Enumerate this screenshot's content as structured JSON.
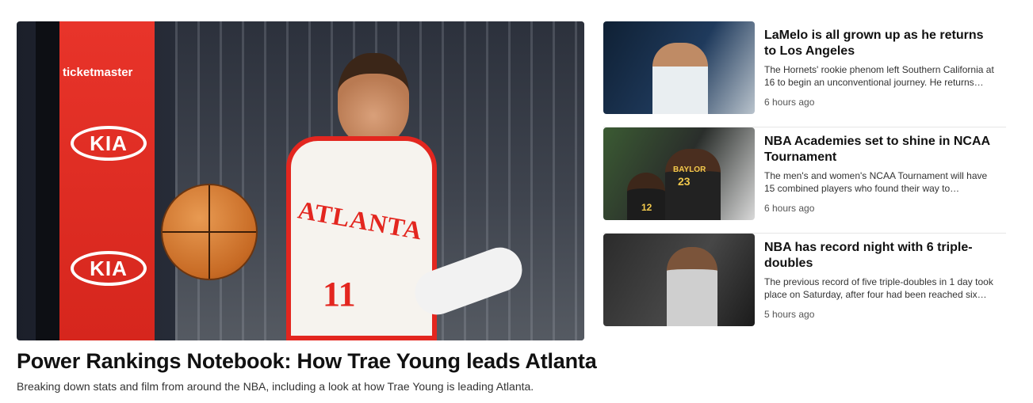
{
  "featured": {
    "title": "Power Rankings Notebook: How Trae Young leads Atlanta",
    "summary": "Breaking down stats and film from around the NBA, including a look at how Trae Young is leading Atlanta.",
    "image": {
      "sponsor": "ticketmaster",
      "brand_mark": "KIA",
      "jersey_team": "ATLANTA",
      "jersey_number": "11"
    }
  },
  "side_stories": [
    {
      "title": "LaMelo is all grown up as he returns to Los Angeles",
      "summary": "The Hornets' rookie phenom left Southern California at 16 to begin an unconventional journey. He returns…",
      "time": "6 hours ago"
    },
    {
      "title": "NBA Academies set to shine in NCAA Tournament",
      "summary": "The men's and women's NCAA Tournament will have 15 combined players who found their way to colleges…",
      "time": "6 hours ago",
      "image": {
        "jersey_text": "BAYLOR",
        "number_a": "23",
        "number_b": "12"
      }
    },
    {
      "title": "NBA has record night with 6 triple-doubles",
      "summary": "The previous record of five triple-doubles in 1 day took place on Saturday, after four had been reached six…",
      "time": "5 hours ago"
    }
  ],
  "colors": {
    "hawks_red": "#e3261f",
    "kia_red": "#d6261d",
    "text_primary": "#111111",
    "text_muted": "#555555",
    "divider": "#e6e6e6"
  }
}
